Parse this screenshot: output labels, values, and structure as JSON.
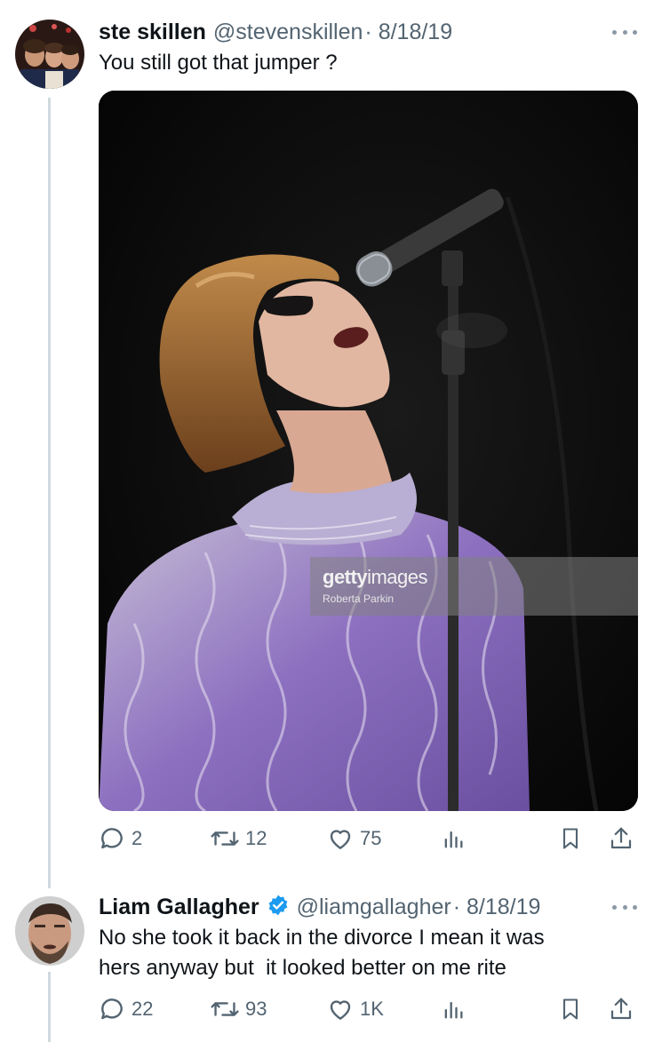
{
  "tweet1": {
    "display_name": "ste skillen",
    "handle": "@stevenskillen",
    "date": "· 8/18/19",
    "text": "You still got that jumper ?",
    "media": {
      "watermark_brand_bold": "getty",
      "watermark_brand_light": "images",
      "watermark_credit": "Roberta Parkin"
    },
    "actions": {
      "replies": "2",
      "retweets": "12",
      "likes": "75"
    }
  },
  "tweet2": {
    "display_name": "Liam Gallagher",
    "handle": "@liamgallagher",
    "date": "· 8/18/19",
    "text_line1": "No she took it back in the divorce I mean it was",
    "text_line2": "hers anyway but  it looked better on me rite",
    "actions": {
      "replies": "22",
      "retweets": "93",
      "likes": "1K"
    }
  },
  "colors": {
    "text_primary": "#0f1419",
    "text_secondary": "#536471",
    "verified_blue": "#1d9bf0",
    "thread_line": "#cfd9de"
  },
  "icons": [
    "reply-icon",
    "retweet-icon",
    "like-icon",
    "views-icon",
    "bookmark-icon",
    "share-icon",
    "more-icon",
    "verified-badge-icon"
  ]
}
